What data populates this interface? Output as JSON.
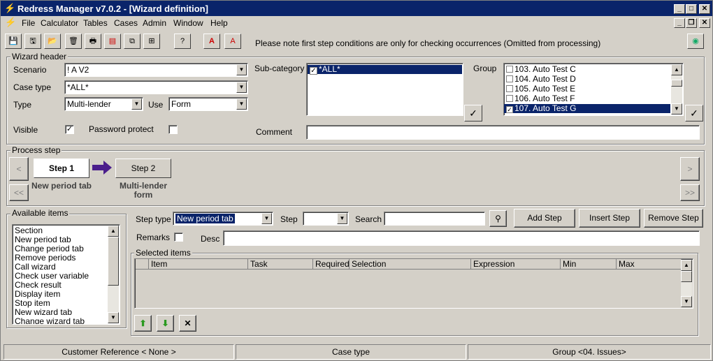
{
  "window": {
    "title": "Redress Manager v7.0.2 - [Wizard definition]"
  },
  "menu": [
    "File",
    "Calculator",
    "Tables",
    "Cases",
    "Admin",
    "Window",
    "Help"
  ],
  "toolbar": {
    "notice": "Please note first step conditions are only for checking occurrences (Omitted from processing)"
  },
  "wizard_header": {
    "label": "Wizard header",
    "scenario_label": "Scenario",
    "scenario_value": "! A V2",
    "case_type_label": "Case type",
    "case_type_value": "*ALL*",
    "type_label": "Type",
    "type_value": "Multi-lender",
    "use_label": "Use",
    "use_value": "Form",
    "visible_label": "Visible",
    "visible_checked": "✓",
    "password_label": "Password protect",
    "subcategory_label": "Sub-category",
    "subcategory_items": [
      {
        "text": "*ALL*",
        "checked": "✓"
      }
    ],
    "group_label": "Group",
    "group_items": [
      {
        "text": "103. Auto Test C",
        "checked": ""
      },
      {
        "text": "104. Auto Test D",
        "checked": ""
      },
      {
        "text": "105. Auto Test E",
        "checked": ""
      },
      {
        "text": "106. Auto Test F",
        "checked": ""
      },
      {
        "text": "107. Auto Test G",
        "checked": "✓"
      }
    ],
    "comment_label": "Comment",
    "comment_value": ""
  },
  "process_step": {
    "label": "Process step",
    "steps": [
      {
        "label": "Step 1",
        "caption1": "New period tab",
        "caption2": ""
      },
      {
        "label": "Step 2",
        "caption1": "Multi-lender",
        "caption2": "form"
      }
    ],
    "prev": "<",
    "first": "<<",
    "next": ">",
    "last": ">>"
  },
  "available_items": {
    "label": "Available items",
    "items": [
      "Section",
      "New period tab",
      "Change period tab",
      "Remove periods",
      "Call wizard",
      "Check user variable",
      "Check result",
      "Display item",
      "Stop item",
      "New wizard tab",
      "Change wizard tab"
    ]
  },
  "step_editor": {
    "step_type_label": "Step type",
    "step_type_value": "New period tab",
    "step_label": "Step",
    "step_value": "",
    "search_label": "Search",
    "search_value": "",
    "add_step": "Add Step",
    "insert_step": "Insert Step",
    "remove_step": "Remove Step",
    "remarks_label": "Remarks",
    "desc_label": "Desc",
    "desc_value": ""
  },
  "selected_items": {
    "label": "Selected items",
    "columns": [
      "",
      "Item",
      "Task",
      "Required",
      "Selection",
      "Expression",
      "Min",
      "Max"
    ]
  },
  "statusbar": {
    "customer": "Customer Reference < None >",
    "case_type": "Case type",
    "group": "Group <04. Issues>"
  }
}
